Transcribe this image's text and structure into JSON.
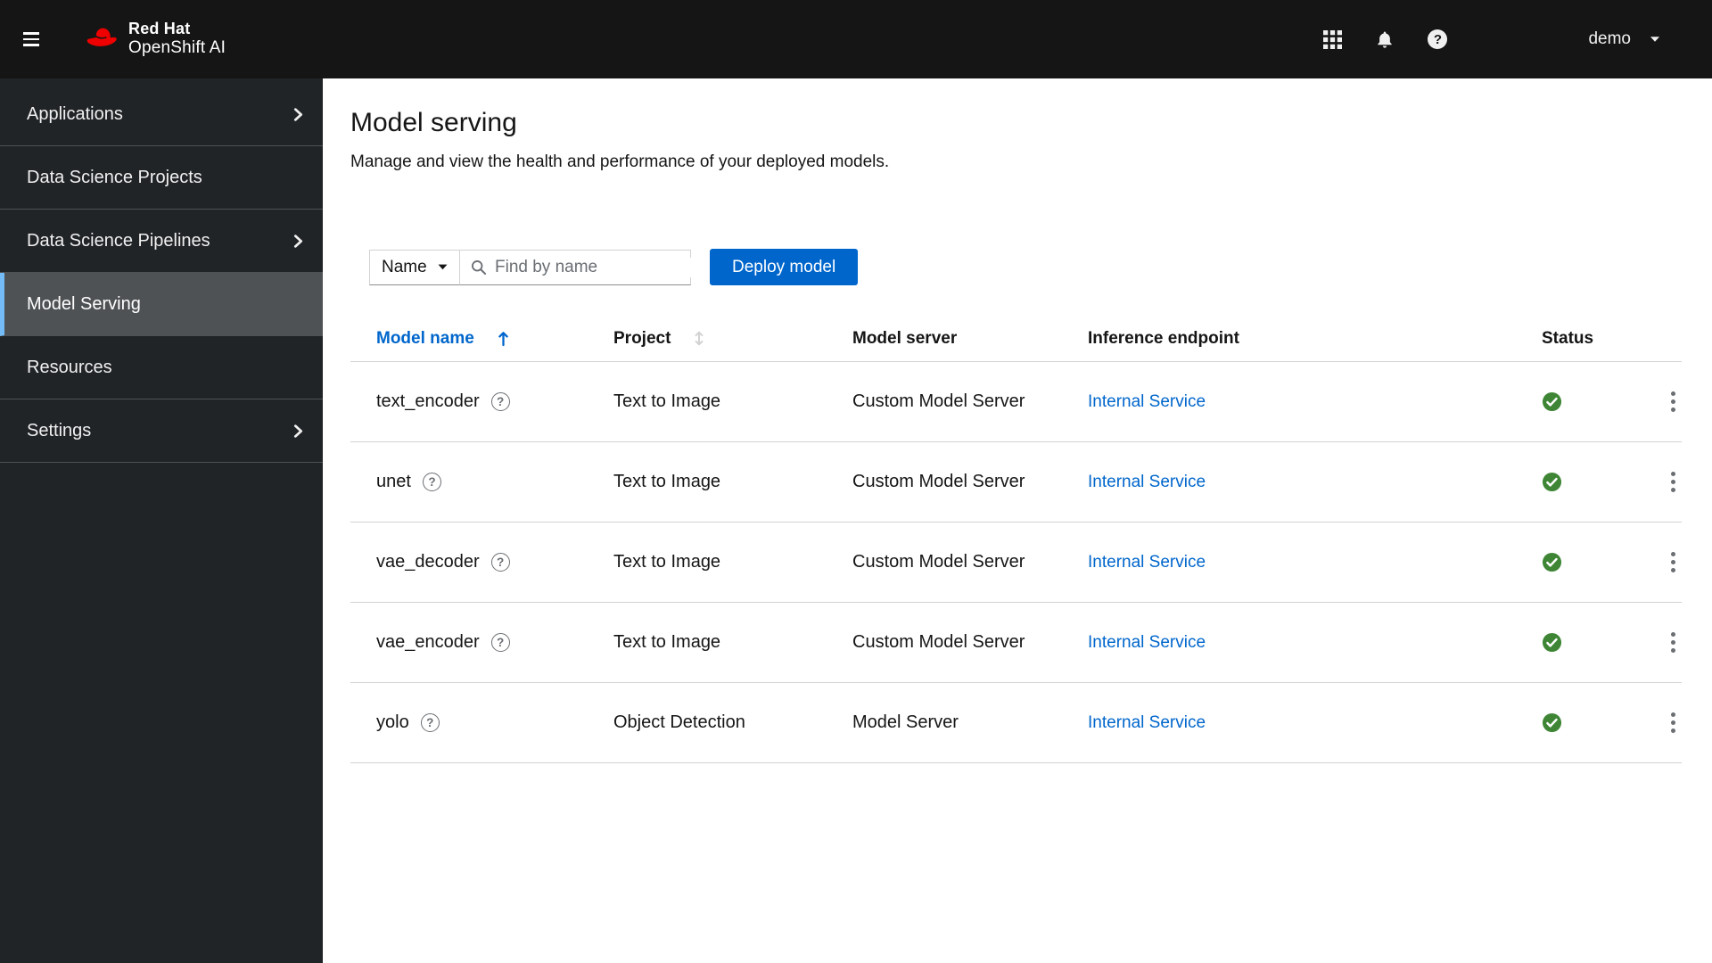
{
  "masthead": {
    "brand_top": "Red Hat",
    "brand_bottom": "OpenShift AI",
    "user": "demo",
    "icons": [
      "menu-icon",
      "app-launcher-icon",
      "notifications-icon",
      "help-icon",
      "caret-down-icon"
    ]
  },
  "sidebar": {
    "items": [
      {
        "label": "Applications",
        "expandable": true,
        "selected": false
      },
      {
        "label": "Data Science Projects",
        "expandable": false,
        "selected": false
      },
      {
        "label": "Data Science Pipelines",
        "expandable": true,
        "selected": false
      },
      {
        "label": "Model Serving",
        "expandable": false,
        "selected": true
      },
      {
        "label": "Resources",
        "expandable": false,
        "selected": false
      },
      {
        "label": "Settings",
        "expandable": true,
        "selected": false
      }
    ]
  },
  "page": {
    "title": "Model serving",
    "subtitle": "Manage and view the health and performance of your deployed models."
  },
  "toolbar": {
    "filter_label": "Name",
    "search_placeholder": "Find by name",
    "search_value": "",
    "deploy_button": "Deploy model"
  },
  "table": {
    "columns": [
      "Model name",
      "Project",
      "Model server",
      "Inference endpoint",
      "Status"
    ],
    "sort": {
      "column": "Model name",
      "direction": "ascending"
    },
    "rows": [
      {
        "name": "text_encoder",
        "project": "Text to Image",
        "server": "Custom Model Server",
        "endpoint": "Internal Service",
        "status": "success"
      },
      {
        "name": "unet",
        "project": "Text to Image",
        "server": "Custom Model Server",
        "endpoint": "Internal Service",
        "status": "success"
      },
      {
        "name": "vae_decoder",
        "project": "Text to Image",
        "server": "Custom Model Server",
        "endpoint": "Internal Service",
        "status": "success"
      },
      {
        "name": "vae_encoder",
        "project": "Text to Image",
        "server": "Custom Model Server",
        "endpoint": "Internal Service",
        "status": "success"
      },
      {
        "name": "yolo",
        "project": "Object Detection",
        "server": "Model Server",
        "endpoint": "Internal Service",
        "status": "success"
      }
    ]
  },
  "colors": {
    "brand_red": "#ee0000",
    "masthead_bg": "#151515",
    "sidebar_bg": "#212427",
    "nav_selected_bg": "#4f5255",
    "nav_selected_border": "#73bcf7",
    "link_blue": "#0066cc",
    "primary_button": "#0066cc",
    "success_green": "#3e8635"
  }
}
